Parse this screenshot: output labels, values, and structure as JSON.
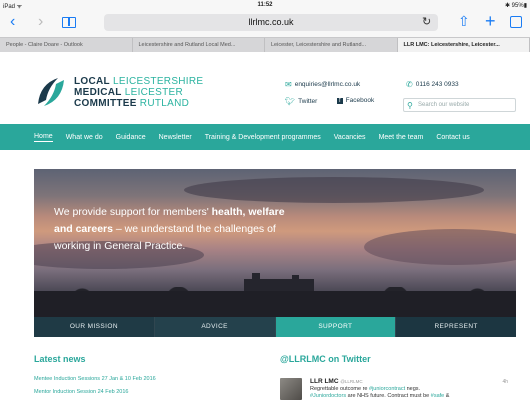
{
  "status": {
    "device": "iPad ᯤ",
    "time": "11:52",
    "battery": "✱ 95%▮"
  },
  "browser": {
    "back": "‹",
    "forward": "›",
    "url": "llrlmc.co.uk",
    "reload": "↻",
    "share": "⇧",
    "plus": "+",
    "tabs": [
      "People - Claire Doare - Outlook",
      "Leicestershire and Rutland Local Med...",
      "Leicester, Leicestershire and Rutland...",
      "LLR LMC: Leicestershire, Leicester..."
    ]
  },
  "site": {
    "logo": {
      "line1_bold": "LOCAL",
      "line1_thin": "LEICESTERSHIRE",
      "line2_bold": "MEDICAL",
      "line2_thin": "LEICESTER",
      "line3_bold": "COMMITTEE",
      "line3_thin": "RUTLAND"
    },
    "email": "enquiries@llrlmc.co.uk",
    "phone": "0116 243 0933",
    "twitter": "Twitter",
    "facebook": "Facebook",
    "search_placeholder": "Search our website",
    "nav": [
      "Home",
      "What we do",
      "Guidance",
      "Newsletter",
      "Training & Development programmes",
      "Vacancies",
      "Meet the team",
      "Contact us"
    ],
    "hero": {
      "t1": "We provide support for members' ",
      "t1b": "health, welfare",
      "t2b": "and careers",
      "t2": " – we understand the challenges of",
      "t3": "working in General Practice."
    },
    "hero_tabs": [
      "OUR MISSION",
      "ADVICE",
      "SUPPORT",
      "REPRESENT"
    ],
    "news": {
      "title": "Latest news",
      "items": [
        "Mentee Induction Sessions 27 Jan & 10 Feb 2016",
        "Mentor Induction Session 24 Feb 2016"
      ]
    },
    "twitter_section": {
      "title": "@LLRLMC on Twitter",
      "tweet": {
        "name": "LLR LMC",
        "handle": "@LLRLMC",
        "time": "4h",
        "l1a": "Regrettable outcome re ",
        "l1h": "#juniorcontract",
        "l1b": " negs.",
        "l2h": "#Juniordoctors",
        "l2a": " are NHS future. Contract must be ",
        "l2h2": "#safe",
        "l2b": " &"
      }
    }
  }
}
